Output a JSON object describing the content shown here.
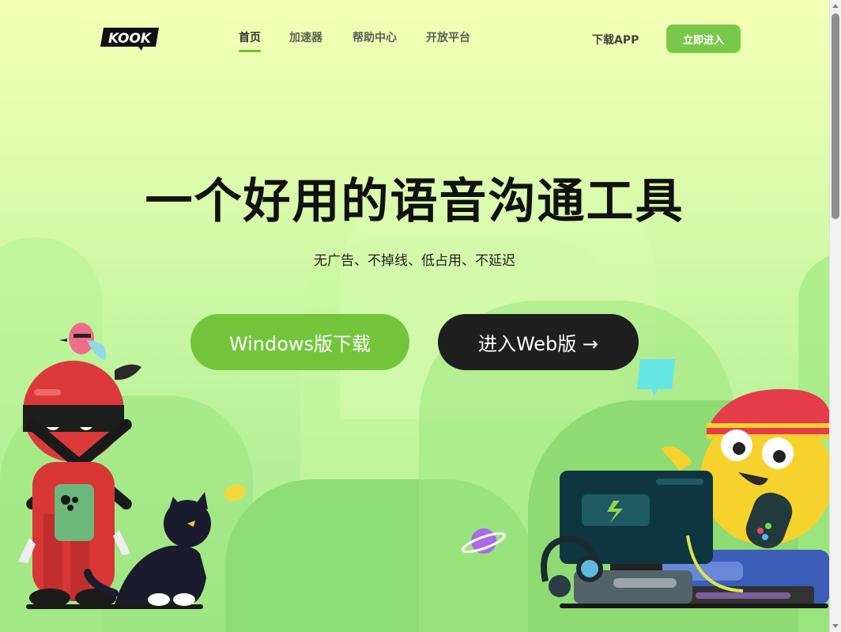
{
  "header": {
    "logo_text": "KOOK",
    "nav": [
      {
        "label": "首页",
        "active": true
      },
      {
        "label": "加速器",
        "active": false
      },
      {
        "label": "帮助中心",
        "active": false
      },
      {
        "label": "开放平台",
        "active": false
      }
    ],
    "download_app": "下载APP",
    "enter_button": "立即进入"
  },
  "hero": {
    "title": "一个好用的语音沟通工具",
    "subtitle": "无广告、不掉线、低占用、不延迟",
    "windows_button": "Windows版下载",
    "web_button": "进入Web版 →"
  },
  "colors": {
    "accent": "#74c53c",
    "dark_button": "#1f1f1f",
    "background_top": "#f3ffb4",
    "background_bottom": "#a6ea8f"
  },
  "icons": [
    "kook-logo",
    "ninja-character-illustration",
    "parrot-illustration",
    "cat-illustration",
    "planet-icon",
    "chat-bubble-icon",
    "gamer-character-illustration",
    "monitor-illustration",
    "headset-illustration",
    "gamepad-illustration"
  ]
}
